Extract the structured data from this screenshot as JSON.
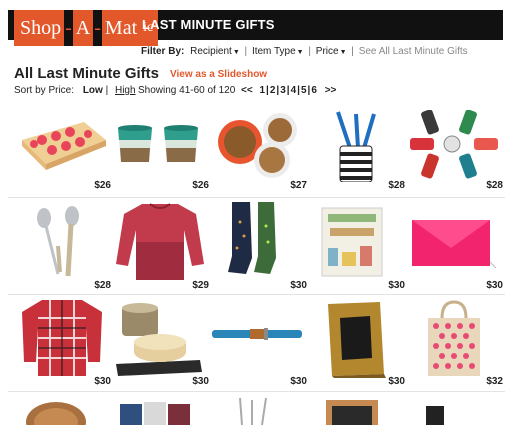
{
  "logo": {
    "seg1": "Shop",
    "seg2": "-",
    "seg3": "A",
    "seg4": "-",
    "seg5": "Mat",
    "seg6": "ic"
  },
  "banner": {
    "title": "LAST MINUTE GIFTS"
  },
  "filters": {
    "label": "Filter By:",
    "recipient": "Recipient",
    "item_type": "Item Type",
    "price": "Price",
    "see_all": "See All Last Minute Gifts"
  },
  "heading": {
    "title": "All Last Minute Gifts",
    "slideshow": "View as a Slideshow"
  },
  "sort": {
    "label": "Sort by Price:",
    "low": "Low",
    "sep": "|",
    "high": "High",
    "showing": "Showing 41-60 of 120"
  },
  "pager": {
    "prev": "<<",
    "pages": [
      "1",
      "2",
      "3",
      "4",
      "5",
      "6"
    ],
    "next": ">>"
  },
  "products": [
    {
      "name": "cake-product",
      "price": "$26"
    },
    {
      "name": "cups-product",
      "price": "$26"
    },
    {
      "name": "bowls-product",
      "price": "$27"
    },
    {
      "name": "pen-holder-product",
      "price": "$28"
    },
    {
      "name": "luggage-tags-product",
      "price": "$28"
    },
    {
      "name": "serving-spoons-product",
      "price": "$28"
    },
    {
      "name": "sweater-product",
      "price": "$29"
    },
    {
      "name": "socks-product",
      "price": "$30"
    },
    {
      "name": "book-product",
      "price": "$30"
    },
    {
      "name": "clutch-product",
      "price": "$30"
    },
    {
      "name": "flannel-shirt-product",
      "price": "$30"
    },
    {
      "name": "cheese-tin-product",
      "price": "$30"
    },
    {
      "name": "belt-product",
      "price": "$30"
    },
    {
      "name": "frame-product",
      "price": "$30"
    },
    {
      "name": "tote-bag-product",
      "price": "$32"
    }
  ],
  "colors": {
    "brand": "#e2582b",
    "bar": "#111111"
  }
}
